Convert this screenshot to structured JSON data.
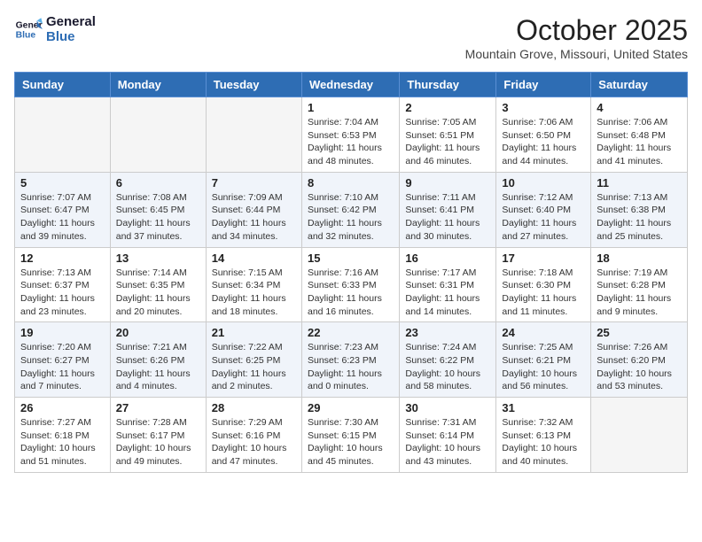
{
  "header": {
    "logo_line1": "General",
    "logo_line2": "Blue",
    "month": "October 2025",
    "location": "Mountain Grove, Missouri, United States"
  },
  "weekdays": [
    "Sunday",
    "Monday",
    "Tuesday",
    "Wednesday",
    "Thursday",
    "Friday",
    "Saturday"
  ],
  "weeks": [
    [
      {
        "day": "",
        "info": ""
      },
      {
        "day": "",
        "info": ""
      },
      {
        "day": "",
        "info": ""
      },
      {
        "day": "1",
        "info": "Sunrise: 7:04 AM\nSunset: 6:53 PM\nDaylight: 11 hours\nand 48 minutes."
      },
      {
        "day": "2",
        "info": "Sunrise: 7:05 AM\nSunset: 6:51 PM\nDaylight: 11 hours\nand 46 minutes."
      },
      {
        "day": "3",
        "info": "Sunrise: 7:06 AM\nSunset: 6:50 PM\nDaylight: 11 hours\nand 44 minutes."
      },
      {
        "day": "4",
        "info": "Sunrise: 7:06 AM\nSunset: 6:48 PM\nDaylight: 11 hours\nand 41 minutes."
      }
    ],
    [
      {
        "day": "5",
        "info": "Sunrise: 7:07 AM\nSunset: 6:47 PM\nDaylight: 11 hours\nand 39 minutes."
      },
      {
        "day": "6",
        "info": "Sunrise: 7:08 AM\nSunset: 6:45 PM\nDaylight: 11 hours\nand 37 minutes."
      },
      {
        "day": "7",
        "info": "Sunrise: 7:09 AM\nSunset: 6:44 PM\nDaylight: 11 hours\nand 34 minutes."
      },
      {
        "day": "8",
        "info": "Sunrise: 7:10 AM\nSunset: 6:42 PM\nDaylight: 11 hours\nand 32 minutes."
      },
      {
        "day": "9",
        "info": "Sunrise: 7:11 AM\nSunset: 6:41 PM\nDaylight: 11 hours\nand 30 minutes."
      },
      {
        "day": "10",
        "info": "Sunrise: 7:12 AM\nSunset: 6:40 PM\nDaylight: 11 hours\nand 27 minutes."
      },
      {
        "day": "11",
        "info": "Sunrise: 7:13 AM\nSunset: 6:38 PM\nDaylight: 11 hours\nand 25 minutes."
      }
    ],
    [
      {
        "day": "12",
        "info": "Sunrise: 7:13 AM\nSunset: 6:37 PM\nDaylight: 11 hours\nand 23 minutes."
      },
      {
        "day": "13",
        "info": "Sunrise: 7:14 AM\nSunset: 6:35 PM\nDaylight: 11 hours\nand 20 minutes."
      },
      {
        "day": "14",
        "info": "Sunrise: 7:15 AM\nSunset: 6:34 PM\nDaylight: 11 hours\nand 18 minutes."
      },
      {
        "day": "15",
        "info": "Sunrise: 7:16 AM\nSunset: 6:33 PM\nDaylight: 11 hours\nand 16 minutes."
      },
      {
        "day": "16",
        "info": "Sunrise: 7:17 AM\nSunset: 6:31 PM\nDaylight: 11 hours\nand 14 minutes."
      },
      {
        "day": "17",
        "info": "Sunrise: 7:18 AM\nSunset: 6:30 PM\nDaylight: 11 hours\nand 11 minutes."
      },
      {
        "day": "18",
        "info": "Sunrise: 7:19 AM\nSunset: 6:28 PM\nDaylight: 11 hours\nand 9 minutes."
      }
    ],
    [
      {
        "day": "19",
        "info": "Sunrise: 7:20 AM\nSunset: 6:27 PM\nDaylight: 11 hours\nand 7 minutes."
      },
      {
        "day": "20",
        "info": "Sunrise: 7:21 AM\nSunset: 6:26 PM\nDaylight: 11 hours\nand 4 minutes."
      },
      {
        "day": "21",
        "info": "Sunrise: 7:22 AM\nSunset: 6:25 PM\nDaylight: 11 hours\nand 2 minutes."
      },
      {
        "day": "22",
        "info": "Sunrise: 7:23 AM\nSunset: 6:23 PM\nDaylight: 11 hours\nand 0 minutes."
      },
      {
        "day": "23",
        "info": "Sunrise: 7:24 AM\nSunset: 6:22 PM\nDaylight: 10 hours\nand 58 minutes."
      },
      {
        "day": "24",
        "info": "Sunrise: 7:25 AM\nSunset: 6:21 PM\nDaylight: 10 hours\nand 56 minutes."
      },
      {
        "day": "25",
        "info": "Sunrise: 7:26 AM\nSunset: 6:20 PM\nDaylight: 10 hours\nand 53 minutes."
      }
    ],
    [
      {
        "day": "26",
        "info": "Sunrise: 7:27 AM\nSunset: 6:18 PM\nDaylight: 10 hours\nand 51 minutes."
      },
      {
        "day": "27",
        "info": "Sunrise: 7:28 AM\nSunset: 6:17 PM\nDaylight: 10 hours\nand 49 minutes."
      },
      {
        "day": "28",
        "info": "Sunrise: 7:29 AM\nSunset: 6:16 PM\nDaylight: 10 hours\nand 47 minutes."
      },
      {
        "day": "29",
        "info": "Sunrise: 7:30 AM\nSunset: 6:15 PM\nDaylight: 10 hours\nand 45 minutes."
      },
      {
        "day": "30",
        "info": "Sunrise: 7:31 AM\nSunset: 6:14 PM\nDaylight: 10 hours\nand 43 minutes."
      },
      {
        "day": "31",
        "info": "Sunrise: 7:32 AM\nSunset: 6:13 PM\nDaylight: 10 hours\nand 40 minutes."
      },
      {
        "day": "",
        "info": ""
      }
    ]
  ]
}
